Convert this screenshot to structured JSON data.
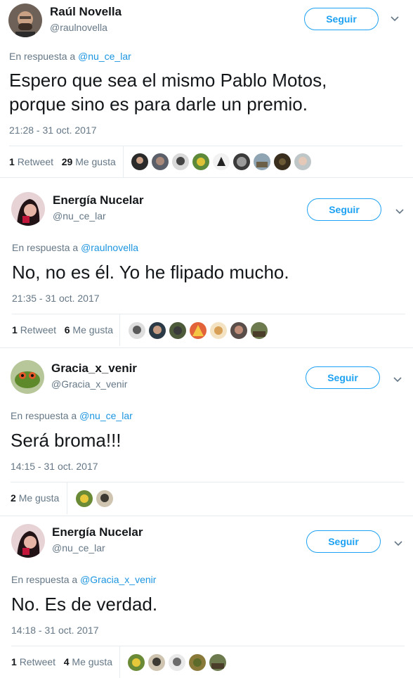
{
  "tweets": [
    {
      "name": "Raúl Novella",
      "handle": "@raulnovella",
      "follow_label": "Seguir",
      "reply_prefix": "En respuesta a",
      "reply_to": "@nu_ce_lar",
      "text_lines": [
        "Espero que sea el mismo Pablo Motos,",
        "porque sino es para darle un premio."
      ],
      "time": "21:28 - 31 oct. 2017",
      "retweets": "1",
      "retweet_label": "Retweet",
      "likes": "29",
      "likes_label": "Me gusta",
      "liker_count": 9
    },
    {
      "name": "Energía Nucelar",
      "handle": "@nu_ce_lar",
      "follow_label": "Seguir",
      "reply_prefix": "En respuesta a",
      "reply_to": "@raulnovella",
      "text_lines": [
        "No, no es él. Yo he flipado mucho."
      ],
      "time": "21:35 - 31 oct. 2017",
      "retweets": "1",
      "retweet_label": "Retweet",
      "likes": "6",
      "likes_label": "Me gusta",
      "liker_count": 7
    },
    {
      "name": "Gracia_x_venir",
      "handle": "@Gracia_x_venir",
      "follow_label": "Seguir",
      "reply_prefix": "En respuesta a",
      "reply_to": "@nu_ce_lar",
      "text_lines": [
        "Será broma!!!"
      ],
      "time": "14:15 - 31 oct. 2017",
      "retweets": "",
      "retweet_label": "",
      "likes": "2",
      "likes_label": "Me gusta",
      "liker_count": 2
    },
    {
      "name": "Energía Nucelar",
      "handle": "@nu_ce_lar",
      "follow_label": "Seguir",
      "reply_prefix": "En respuesta a",
      "reply_to": "@Gracia_x_venir",
      "text_lines": [
        "No. Es de verdad."
      ],
      "time": "14:18 - 31 oct. 2017",
      "retweets": "1",
      "retweet_label": "Retweet",
      "likes": "4",
      "likes_label": "Me gusta",
      "liker_count": 5
    }
  ],
  "icons": {
    "caret": "chevron-down-icon"
  },
  "colors": {
    "accent": "#1da1f2",
    "mention": "#1b95e0",
    "muted": "#657786",
    "rule": "#e6ecf0"
  }
}
